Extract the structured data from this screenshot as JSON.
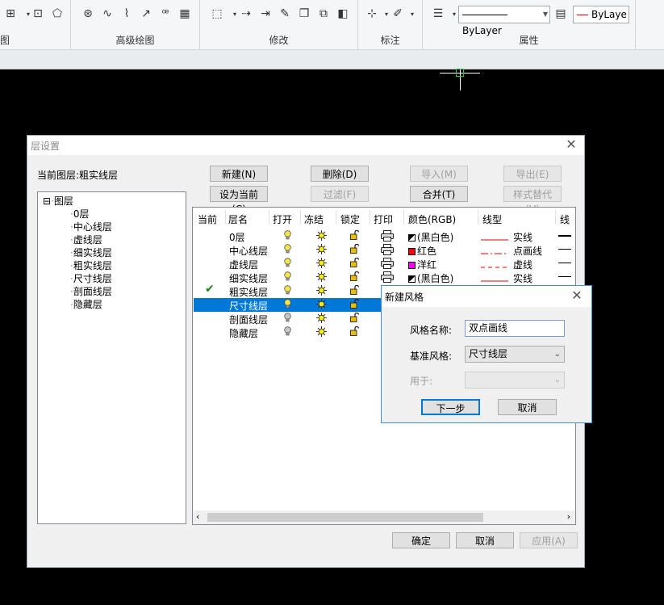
{
  "ribbon": {
    "groups": {
      "draw": "图",
      "advanced": "高级绘图",
      "modify": "修改",
      "dimension": "标注",
      "properties": "属性"
    },
    "bylayer_linetype": "ByLayer",
    "bylayer_color": "ByLaye"
  },
  "layer_dialog": {
    "title": "层设置",
    "current_layer": "当前图层:粗实线层",
    "buttons": {
      "new": "新建(N)",
      "delete": "删除(D)",
      "import": "导入(M)",
      "export": "导出(E)",
      "set_current": "设为当前(C)",
      "filter": "过滤(F)",
      "merge": "合并(T)",
      "style_override": "样式替代(V)",
      "ok": "确定",
      "cancel": "取消",
      "apply": "应用(A)"
    },
    "tree": {
      "root": "图层",
      "items": [
        "0层",
        "中心线层",
        "虚线层",
        "细实线层",
        "粗实线层",
        "尺寸线层",
        "剖面线层",
        "隐藏层"
      ]
    },
    "columns": [
      "当前",
      "层名",
      "打开",
      "冻结",
      "锁定",
      "打印",
      "颜色(RGB)",
      "线型",
      "线"
    ],
    "rows": [
      {
        "name": "0层",
        "color_name": "(黑白色)",
        "color_hex": "#000000",
        "linetype": "实线",
        "current": "",
        "bulb_on": true
      },
      {
        "name": "中心线层",
        "color_name": "红色",
        "color_hex": "#ff0000",
        "linetype": "点画线",
        "current": "",
        "bulb_on": true
      },
      {
        "name": "虚线层",
        "color_name": "洋红",
        "color_hex": "#ff00ff",
        "linetype": "虚线",
        "current": "",
        "bulb_on": true
      },
      {
        "name": "细实线层",
        "color_name": "(黑白色)",
        "color_hex": "#000000",
        "linetype": "实线",
        "current": "",
        "bulb_on": true
      },
      {
        "name": "粗实线层",
        "color_name": "",
        "color_hex": "",
        "linetype": "",
        "current": "✔",
        "bulb_on": true
      },
      {
        "name": "尺寸线层",
        "color_name": "",
        "color_hex": "",
        "linetype": "",
        "current": "",
        "bulb_on": true
      },
      {
        "name": "剖面线层",
        "color_name": "",
        "color_hex": "",
        "linetype": "",
        "current": "",
        "bulb_on": false
      },
      {
        "name": "隐藏层",
        "color_name": "",
        "color_hex": "",
        "linetype": "",
        "current": "",
        "bulb_on": false
      }
    ],
    "selected_row": 5
  },
  "new_style_dialog": {
    "title": "新建风格",
    "name_label": "风格名称:",
    "name_value": "双点画线",
    "base_label": "基准风格:",
    "base_value": "尺寸线层",
    "use_label": "用于:",
    "use_value": "",
    "next_button": "下一步",
    "cancel_button": "取消"
  },
  "colors": {
    "selection": "#0078d7",
    "check": "#1e7e1e",
    "bulb": "#f5e74a"
  }
}
